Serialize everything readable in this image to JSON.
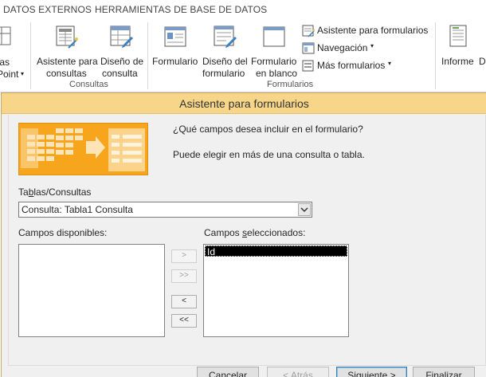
{
  "ribbon": {
    "tabs": [
      "DATOS EXTERNOS",
      "HERRAMIENTAS DE BASE DE DATOS"
    ],
    "partial_button": {
      "line1": "tas",
      "line2": "Point"
    },
    "consultas": {
      "wizard": {
        "line1": "Asistente para",
        "line2": "consultas"
      },
      "design": {
        "line1": "Diseño de",
        "line2": "consulta"
      },
      "group_label": "Consultas"
    },
    "formularios": {
      "form": {
        "line1": "Formulario"
      },
      "design": {
        "line1": "Diseño del",
        "line2": "formulario"
      },
      "blank": {
        "line1": "Formulario",
        "line2": "en blanco"
      },
      "wizard_small": "Asistente para formularios",
      "navigation_small": "Navegación",
      "more_small": "Más formularios",
      "group_label": "Formularios"
    },
    "informe": {
      "line1": "Informe"
    },
    "partial_next": "D"
  },
  "dialog": {
    "title": "Asistente para formularios",
    "question": "¿Qué campos desea incluir en el formulario?",
    "hint": "Puede elegir en más de una consulta o tabla.",
    "tables_label_pre": "Ta",
    "tables_label_ul": "b",
    "tables_label_post": "las/Consultas",
    "tables_value": "Consulta: Tabla1 Consulta",
    "available_label": "Campos disponibles:",
    "selected_label_pre": "Campos ",
    "selected_label_ul": "s",
    "selected_label_post": "eleccionados:",
    "selected_fields": [
      "Id"
    ],
    "move_buttons": {
      "add_one": ">",
      "add_all": ">>",
      "remove_one": "<",
      "remove_all": "<<"
    },
    "buttons": {
      "cancel": "Cancelar",
      "back": "< Atrás",
      "next": "Siguiente >",
      "finish": "Finalizar"
    }
  },
  "colors": {
    "titlebar": "#f7d689",
    "banner": "#f7a51c",
    "selection": "#000000"
  }
}
